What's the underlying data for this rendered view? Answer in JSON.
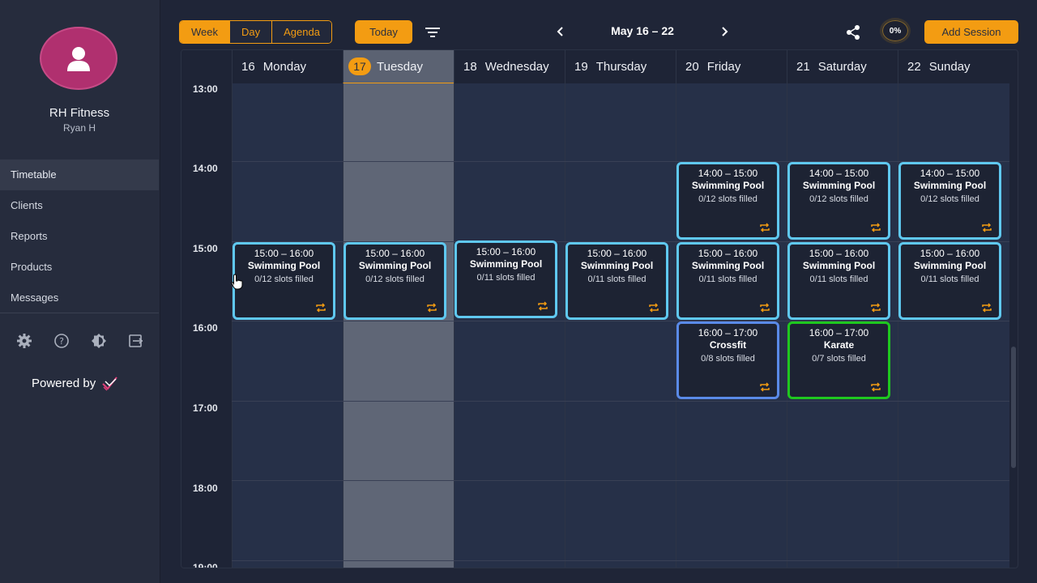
{
  "sidebar": {
    "brand_name": "RH Fitness",
    "user_name": "Ryan H",
    "nav": [
      {
        "label": "Timetable",
        "active": true
      },
      {
        "label": "Clients"
      },
      {
        "label": "Reports"
      },
      {
        "label": "Products"
      },
      {
        "label": "Messages"
      }
    ],
    "icons": [
      "gear-icon",
      "help-icon",
      "theme-icon",
      "logout-icon"
    ],
    "powered_by": "Powered by"
  },
  "toolbar": {
    "views": [
      "Week",
      "Day",
      "Agenda"
    ],
    "active_view": "Week",
    "today_label": "Today",
    "date_range": "May 16 – 22",
    "progress": "0%",
    "add_label": "Add Session"
  },
  "calendar": {
    "days": [
      {
        "num": "16",
        "name": "Monday"
      },
      {
        "num": "17",
        "name": "Tuesday",
        "today": true
      },
      {
        "num": "18",
        "name": "Wednesday"
      },
      {
        "num": "19",
        "name": "Thursday"
      },
      {
        "num": "20",
        "name": "Friday"
      },
      {
        "num": "21",
        "name": "Saturday"
      },
      {
        "num": "22",
        "name": "Sunday"
      }
    ],
    "hours": [
      "13:00",
      "14:00",
      "15:00",
      "16:00",
      "17:00",
      "18:00",
      "19:00"
    ],
    "events": [
      {
        "day": 4,
        "time": "14:00 – 15:00",
        "title": "Swimming Pool",
        "slots": "0/12 slots filled"
      },
      {
        "day": 5,
        "time": "14:00 – 15:00",
        "title": "Swimming Pool",
        "slots": "0/12 slots filled"
      },
      {
        "day": 6,
        "time": "14:00 – 15:00",
        "title": "Swimming Pool",
        "slots": "0/12 slots filled"
      },
      {
        "day": 0,
        "time": "15:00 – 16:00",
        "title": "Swimming Pool",
        "slots": "0/12 slots filled"
      },
      {
        "day": 1,
        "time": "15:00 – 16:00",
        "title": "Swimming Pool",
        "slots": "0/12 slots filled"
      },
      {
        "day": 2,
        "time": "15:00 – 16:00",
        "title": "Swimming Pool",
        "slots": "0/11 slots filled"
      },
      {
        "day": 3,
        "time": "15:00 – 16:00",
        "title": "Swimming Pool",
        "slots": "0/11 slots filled"
      },
      {
        "day": 4,
        "time": "15:00 – 16:00",
        "title": "Swimming Pool",
        "slots": "0/11 slots filled"
      },
      {
        "day": 5,
        "time": "15:00 – 16:00",
        "title": "Swimming Pool",
        "slots": "0/11 slots filled"
      },
      {
        "day": 6,
        "time": "15:00 – 16:00",
        "title": "Swimming Pool",
        "slots": "0/11 slots filled"
      },
      {
        "day": 4,
        "time": "16:00 – 17:00",
        "title": "Crossfit",
        "slots": "0/8 slots filled",
        "color": "#5a8ae8"
      },
      {
        "day": 5,
        "time": "16:00 – 17:00",
        "title": "Karate",
        "slots": "0/7 slots filled",
        "color": "#1fc81f"
      }
    ]
  },
  "colors": {
    "accent": "#f39c12",
    "event_default": "#5fc8f0",
    "avatar": "#b0306f"
  }
}
